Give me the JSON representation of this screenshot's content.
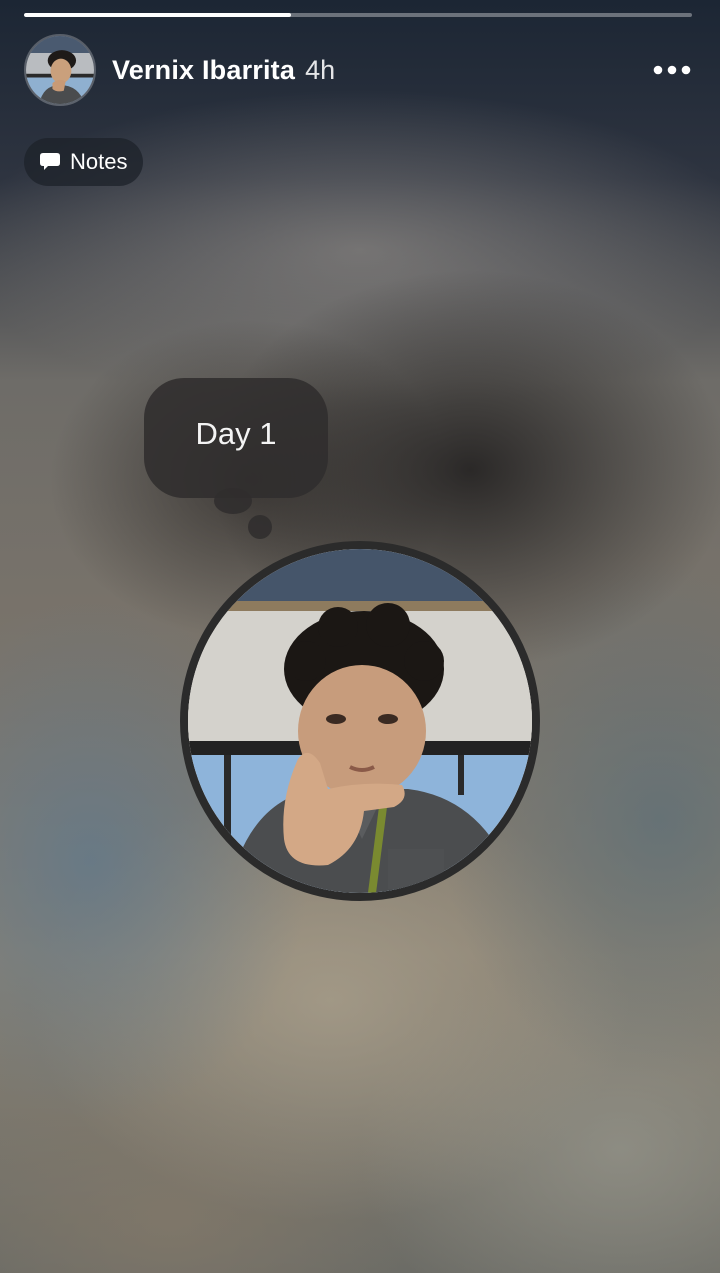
{
  "story": {
    "progress_fraction": 0.4,
    "author": {
      "name": "Vernix Ibarrita",
      "time": "4h"
    },
    "menu_icon": "more-horizontal-icon",
    "category_chip": {
      "icon": "speech-bubble-icon",
      "label": "Notes"
    },
    "note": {
      "text": "Day 1"
    }
  }
}
